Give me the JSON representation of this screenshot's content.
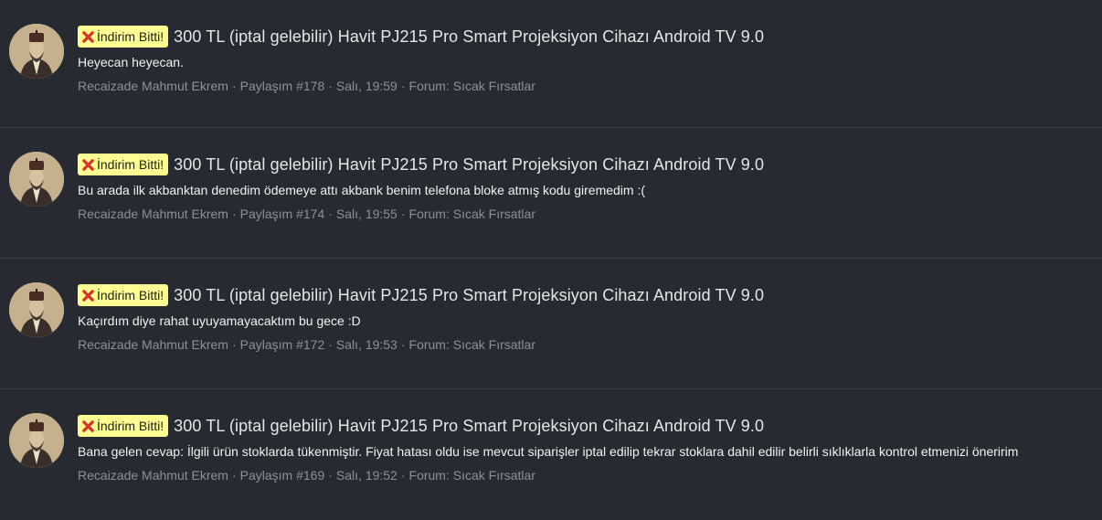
{
  "results": [
    {
      "label": "İndirim Bitti!",
      "title": "300 TL (iptal gelebilir) Havit PJ215 Pro Smart Projeksiyon Cihazı Android TV 9.0",
      "snippet": "Heyecan heyecan.",
      "author": "Recaizade Mahmut Ekrem",
      "post": "Paylaşım #178",
      "date": "Salı, 19:59",
      "forum": "Forum: Sıcak Fırsatlar"
    },
    {
      "label": "İndirim Bitti!",
      "title": "300 TL (iptal gelebilir) Havit PJ215 Pro Smart Projeksiyon Cihazı Android TV 9.0",
      "snippet": "Bu arada ilk akbanktan denedim ödemeye attı akbank benim telefona bloke atmış kodu giremedim :(",
      "author": "Recaizade Mahmut Ekrem",
      "post": "Paylaşım #174",
      "date": "Salı, 19:55",
      "forum": "Forum: Sıcak Fırsatlar"
    },
    {
      "label": "İndirim Bitti!",
      "title": "300 TL (iptal gelebilir) Havit PJ215 Pro Smart Projeksiyon Cihazı Android TV 9.0",
      "snippet": "Kaçırdım diye rahat uyuyamayacaktım bu gece :D",
      "author": "Recaizade Mahmut Ekrem",
      "post": "Paylaşım #172",
      "date": "Salı, 19:53",
      "forum": "Forum: Sıcak Fırsatlar"
    },
    {
      "label": "İndirim Bitti!",
      "title": "300 TL (iptal gelebilir) Havit PJ215 Pro Smart Projeksiyon Cihazı Android TV 9.0",
      "snippet": "Bana gelen cevap: İlgili ürün stoklarda tükenmiştir. Fiyat hatası oldu ise mevcut siparişler iptal edilip tekrar stoklara dahil edilir belirli sıklıklarla kontrol etmenizi öneririm",
      "author": "Recaizade Mahmut Ekrem",
      "post": "Paylaşım #169",
      "date": "Salı, 19:52",
      "forum": "Forum: Sıcak Fırsatlar"
    }
  ],
  "meta_separator": "·",
  "icons": {
    "label_icon": "cross-mark-icon",
    "avatar": "user-avatar"
  },
  "colors": {
    "background": "#272a31",
    "label_bg": "#fdfd91",
    "label_icon": "#d9342b",
    "meta_text": "#8b909a",
    "divider": "#3b3f48"
  }
}
